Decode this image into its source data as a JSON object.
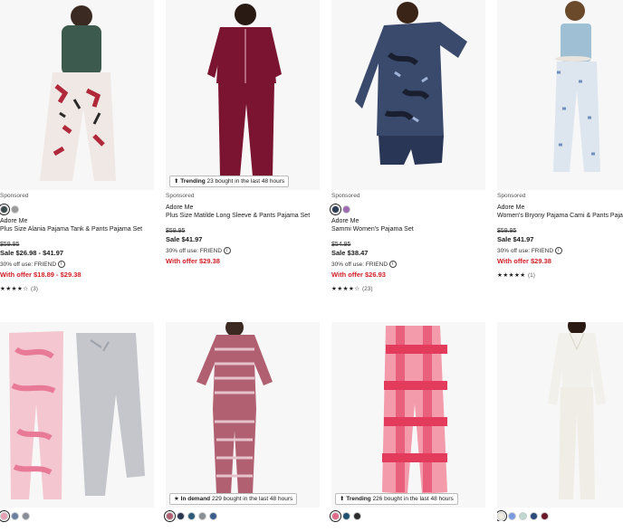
{
  "products": [
    {
      "sponsored": "Sponsored",
      "brand": "Adore Me",
      "title": "Plus Size Alania Pajama Tank & Pants Pajama Set",
      "original_price": "$59.95",
      "sale_price": "Sale $26.98 - $41.97",
      "offer_text": "30% off use: FRIEND",
      "with_offer": "With offer $18.89 - $29.38",
      "stars": "★★★★☆",
      "review_count": "(3)",
      "swatches": [
        "#3d4a4c",
        "#9a9a9a"
      ]
    },
    {
      "sponsored": "Sponsored",
      "brand": "Adore Me",
      "title": "Plus Size Matilde Long Sleeve & Pants Pajama Set",
      "original_price": "$59.95",
      "sale_price": "Sale $41.97",
      "offer_text": "30% off use: FRIEND",
      "with_offer": "With offer $29.38",
      "badge_strong": "Trending",
      "badge_rest": "23 bought in the last 48 hours",
      "swatches": []
    },
    {
      "sponsored": "Sponsored",
      "brand": "Adore Me",
      "title": "Sammi Women's Pajama Set",
      "original_price": "$54.95",
      "sale_price": "Sale $38.47",
      "offer_text": "30% off use: FRIEND",
      "with_offer": "With offer $26.93",
      "stars": "★★★★☆",
      "review_count": "(23)",
      "swatches": [
        "#2e3b55",
        "#a06ab0"
      ]
    },
    {
      "sponsored": "Sponsored",
      "brand": "Adore Me",
      "title": "Women's Bryony Pajama Cami & Pants Pajama Set",
      "original_price": "$59.95",
      "sale_price": "Sale $41.97",
      "offer_text": "30% off use: FRIEND",
      "with_offer": "With offer $29.38",
      "stars": "★★★★★",
      "review_count": "(1)",
      "swatches": []
    },
    {
      "swatches": [
        "#e8a0b4",
        "#6b7fa0",
        "#888e99"
      ]
    },
    {
      "badge_strong": "In demand",
      "badge_rest": "229 bought in the last 48 hours",
      "swatches": [
        "#b06070",
        "#2a3550",
        "#2e5a7a",
        "#8a8f96",
        "#3c5e8c"
      ]
    },
    {
      "badge_strong": "Trending",
      "badge_rest": "226 bought in the last 48 hours",
      "swatches": [
        "#e26a8a",
        "#1f5070",
        "#2b2b2b"
      ]
    },
    {
      "swatches": [
        "#eeeae0",
        "#7a9ae0",
        "#bfd8d0",
        "#2a4a7a",
        "#6a1a2a"
      ]
    }
  ],
  "icons": {
    "info": "i",
    "trend_arrow": "⬆",
    "star_badge": "★"
  }
}
